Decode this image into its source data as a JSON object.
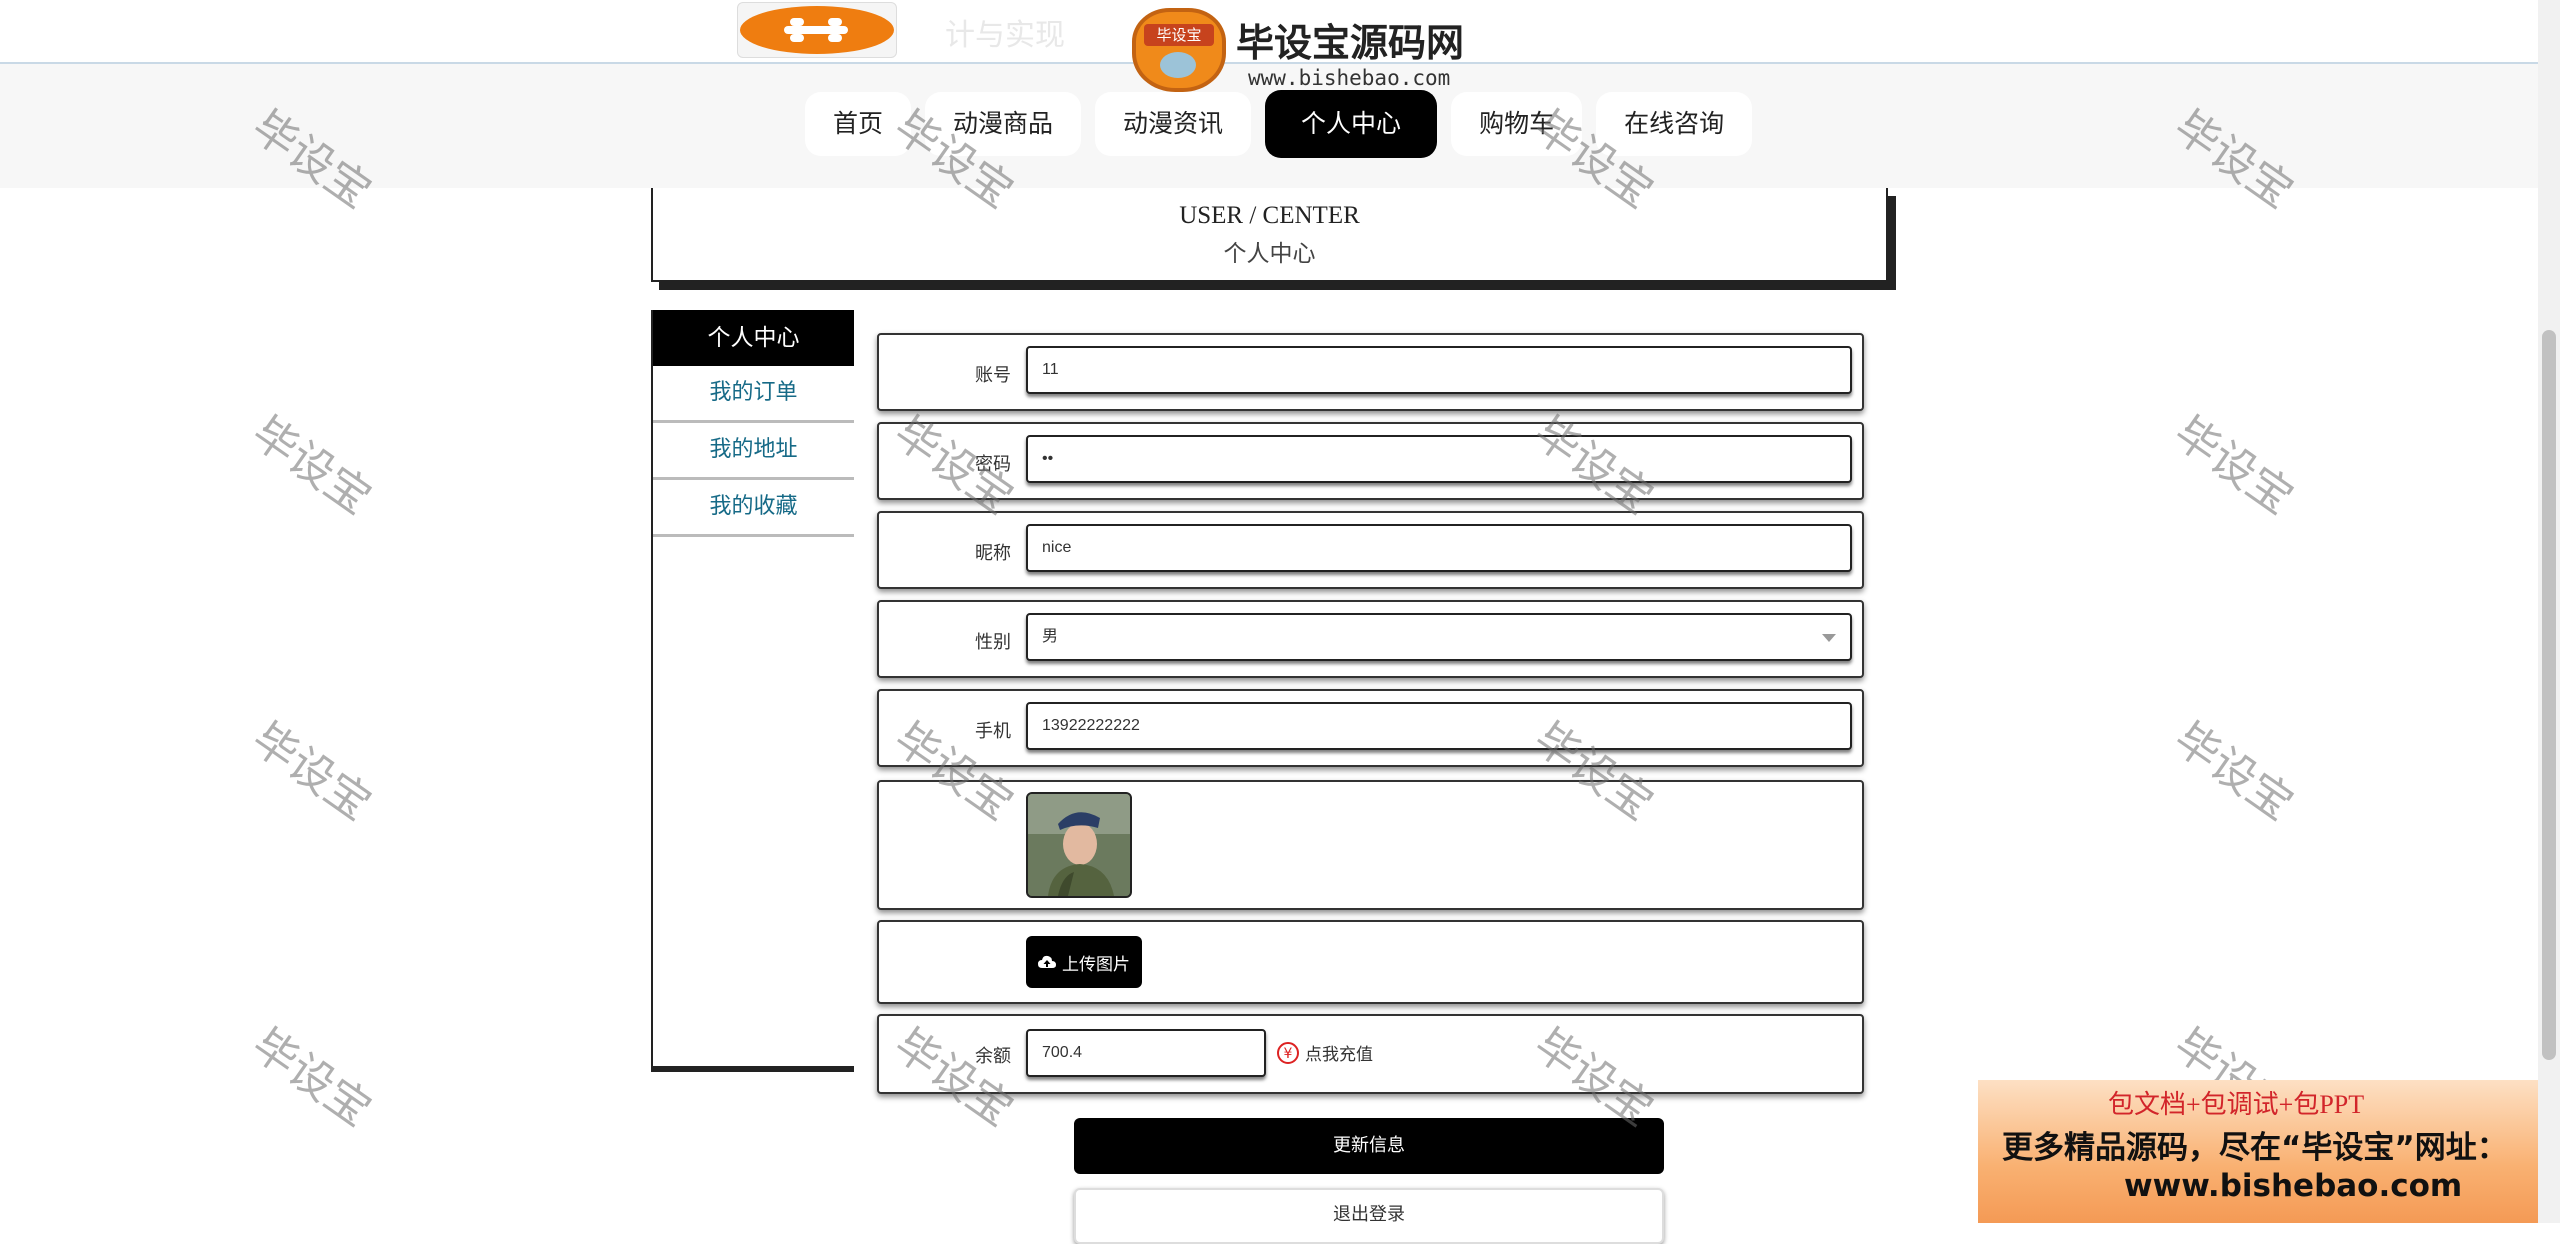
{
  "header": {
    "site_title": "计与实现",
    "overlay_badge": {
      "badge_text": "毕设宝",
      "title": "毕设宝源码网",
      "url": "www.bishebao.com"
    }
  },
  "nav": [
    {
      "label": "首页",
      "active": false
    },
    {
      "label": "动漫商品",
      "active": false
    },
    {
      "label": "动漫资讯",
      "active": false
    },
    {
      "label": "个人中心",
      "active": true
    },
    {
      "label": "购物车",
      "active": false
    },
    {
      "label": "在线咨询",
      "active": false
    }
  ],
  "page_heading": {
    "en": "USER / CENTER",
    "cn": "个人中心"
  },
  "sidebar": {
    "title": "个人中心",
    "items": [
      "我的订单",
      "我的地址",
      "我的收藏"
    ]
  },
  "form": {
    "account": {
      "label": "账号",
      "value": "11"
    },
    "password": {
      "label": "密码",
      "value": "••"
    },
    "nickname": {
      "label": "昵称",
      "value": "nice"
    },
    "gender": {
      "label": "性别",
      "value": "男"
    },
    "phone": {
      "label": "手机",
      "value": "13922222222"
    },
    "upload_label": "上传图片",
    "balance": {
      "label": "余额",
      "value": "700.4"
    },
    "recharge_label": "点我充值"
  },
  "buttons": {
    "update": "更新信息",
    "logout": "退出登录"
  },
  "watermark_text": "毕设宝",
  "promo": {
    "top": "包文档+包调试+包PPT",
    "middle": "更多精品源码，尽在“毕设宝”网址：",
    "url": "www.bishebao.com"
  },
  "icons": {
    "upload": "cloud-upload-icon",
    "recharge": "yen-icon",
    "select": "chevron-down-icon"
  },
  "colors": {
    "accent": "#000000",
    "link": "#166a87",
    "logo": "#ef7d10",
    "promo_red": "#d2252a"
  }
}
